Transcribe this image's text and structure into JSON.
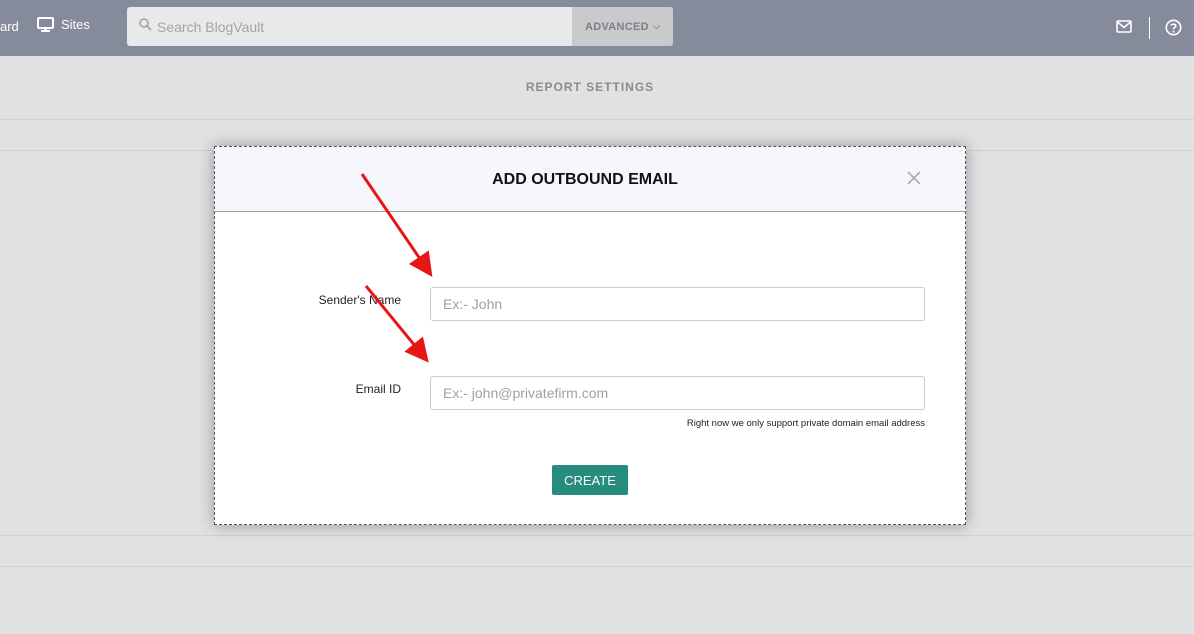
{
  "header": {
    "nav_partial": "ard",
    "nav_sites": "Sites",
    "search_placeholder": "Search BlogVault",
    "advanced_label": "ADVANCED",
    "icons": [
      "monitor-icon",
      "search-icon",
      "chevron-down-icon",
      "mail-icon",
      "help-icon"
    ]
  },
  "page": {
    "title": "REPORT SETTINGS"
  },
  "modal": {
    "title": "ADD OUTBOUND EMAIL",
    "close_icon": "close-icon",
    "fields": [
      {
        "label": "Sender's Name",
        "placeholder": "Ex:- John",
        "value": ""
      },
      {
        "label": "Email ID",
        "placeholder": "Ex:- john@privatefirm.com",
        "value": ""
      }
    ],
    "hint": "Right now we only support private domain email address",
    "create_label": "CREATE"
  },
  "annotations": {
    "arrow_color": "#e81515"
  },
  "colors": {
    "topbar": "#858b9a",
    "accent": "#268c7e"
  }
}
